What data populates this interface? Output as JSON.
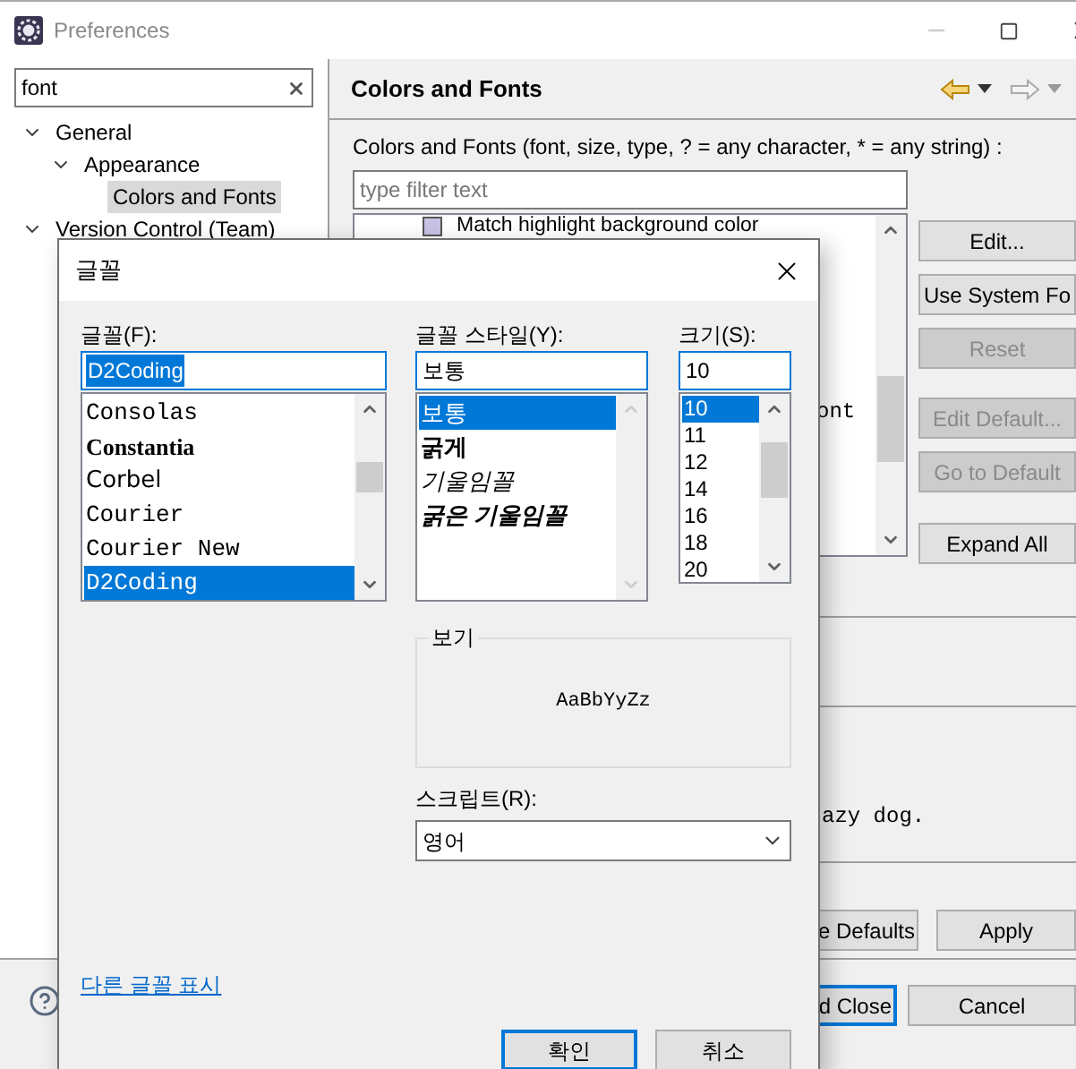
{
  "window": {
    "title": "Preferences"
  },
  "sidebar": {
    "search": {
      "value": "font"
    },
    "tree": [
      {
        "label": "General",
        "expanded": true,
        "selected": false,
        "children": [
          {
            "label": "Appearance",
            "expanded": true,
            "selected": false,
            "children": [
              {
                "label": "Colors and Fonts",
                "selected": true
              }
            ]
          }
        ]
      },
      {
        "label": "Version Control (Team)",
        "expanded": true,
        "selected": false
      }
    ]
  },
  "page": {
    "title": "Colors and Fonts",
    "description": "Colors and Fonts (font, size, type, ? = any character, * = any string) :",
    "filter": {
      "placeholder": "type filter text"
    },
    "list_items": [
      {
        "kind": "color",
        "text": "Match highlight background color",
        "color": "#c9c3e6"
      },
      {
        "kind": "font",
        "text": "ont"
      }
    ],
    "side_buttons": [
      {
        "label": "Edit...",
        "disabled": false
      },
      {
        "label": "Use System Fo",
        "disabled": false
      },
      {
        "label": "Reset",
        "disabled": true
      },
      {
        "label": "Edit Default...",
        "disabled": true
      },
      {
        "label": "Go to Default",
        "disabled": true
      },
      {
        "label": "Expand All",
        "disabled": false
      }
    ],
    "preview_text": "azy dog.",
    "buttons": [
      {
        "label": "e Defaults",
        "default": false
      },
      {
        "label": "Apply",
        "default": false
      }
    ]
  },
  "footer": {
    "buttons": [
      {
        "label": "d Close",
        "default": true
      },
      {
        "label": "Cancel",
        "default": false
      }
    ]
  },
  "font_dialog": {
    "title": "글꼴",
    "font": {
      "label": "글꼴(F):",
      "value": "D2Coding",
      "value_selected": true,
      "items": [
        {
          "text": "Consolas",
          "kind": "mono",
          "selected": false
        },
        {
          "text": "Constantia",
          "kind": "serif",
          "selected": false
        },
        {
          "text": "Corbel",
          "kind": "sans",
          "selected": false
        },
        {
          "text": "Courier",
          "kind": "mono",
          "selected": false
        },
        {
          "text": "Courier New",
          "kind": "mono",
          "selected": false
        },
        {
          "text": "D2Coding",
          "kind": "mono",
          "selected": true
        }
      ]
    },
    "style": {
      "label": "글꼴 스타일(Y):",
      "value": "보통",
      "items": [
        {
          "text": "보통",
          "kind": "regular",
          "selected": true
        },
        {
          "text": "굵게",
          "kind": "bold",
          "selected": false
        },
        {
          "text": "기울임꼴",
          "kind": "italic",
          "selected": false
        },
        {
          "text": "굵은 기울임꼴",
          "kind": "bold-italic",
          "selected": false
        }
      ]
    },
    "size": {
      "label": "크기(S):",
      "value": "10",
      "items": [
        {
          "text": "10",
          "selected": true
        },
        {
          "text": "11",
          "selected": false
        },
        {
          "text": "12",
          "selected": false
        },
        {
          "text": "14",
          "selected": false
        },
        {
          "text": "16",
          "selected": false
        },
        {
          "text": "18",
          "selected": false
        },
        {
          "text": "20",
          "selected": false
        }
      ]
    },
    "sample": {
      "label": "보기",
      "text": "AaBbYyZz"
    },
    "script": {
      "label": "스크립트(R):",
      "value": "영어"
    },
    "link": "다른 글꼴 표시",
    "buttons": [
      {
        "label": "확인",
        "default": true
      },
      {
        "label": "취소",
        "default": false
      }
    ]
  }
}
